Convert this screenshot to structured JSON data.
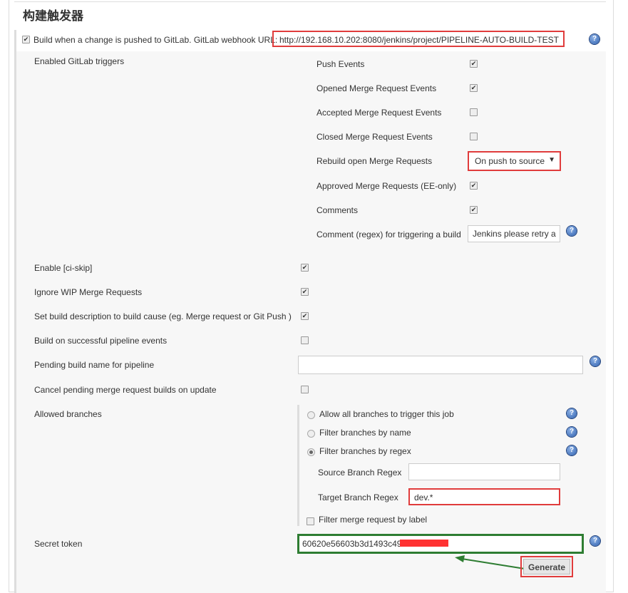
{
  "section_title": "构建触发器",
  "main_trigger": {
    "label": "Build when a change is pushed to GitLab. GitLab webhook URL:",
    "url": "http://192.168.10.202:8080/jenkins/project/PIPELINE-AUTO-BUILD-TEST",
    "checked": true
  },
  "enabled_triggers_label": "Enabled GitLab triggers",
  "triggers": [
    {
      "label": "Push Events",
      "checked": true
    },
    {
      "label": "Opened Merge Request Events",
      "checked": true
    },
    {
      "label": "Accepted Merge Request Events",
      "checked": false
    },
    {
      "label": "Closed Merge Request Events",
      "checked": false
    },
    {
      "label": "Rebuild open Merge Requests",
      "select": "On push to source"
    },
    {
      "label": "Approved Merge Requests (EE-only)",
      "checked": true
    },
    {
      "label": "Comments",
      "checked": true
    },
    {
      "label": "Comment (regex) for triggering a build",
      "value": "Jenkins please retry a"
    }
  ],
  "options": [
    {
      "label": "Enable [ci-skip]",
      "checked": true
    },
    {
      "label": "Ignore WIP Merge Requests",
      "checked": true
    },
    {
      "label": "Set build description to build cause (eg. Merge request or Git Push )",
      "checked": true
    },
    {
      "label": "Build on successful pipeline events",
      "checked": false
    },
    {
      "label": "Pending build name for pipeline",
      "value": ""
    },
    {
      "label": "Cancel pending merge request builds on update",
      "checked": false
    }
  ],
  "allowed_branches": {
    "label": "Allowed branches",
    "radios": [
      {
        "label": "Allow all branches to trigger this job",
        "selected": false
      },
      {
        "label": "Filter branches by name",
        "selected": false
      },
      {
        "label": "Filter branches by regex",
        "selected": true
      }
    ],
    "source_regex_label": "Source Branch Regex",
    "source_regex": "",
    "target_regex_label": "Target Branch Regex",
    "target_regex": "dev.*",
    "filter_label": "Filter merge request by label",
    "filter_checked": false
  },
  "secret_token": {
    "label": "Secret token",
    "value": "60620e56603b3d1493c49"
  },
  "generate_label": "Generate",
  "check_mark": "✔",
  "colors": {
    "highlight_red": "#e03c3c",
    "highlight_green": "#2e7d32",
    "redaction": "#ff3333"
  }
}
